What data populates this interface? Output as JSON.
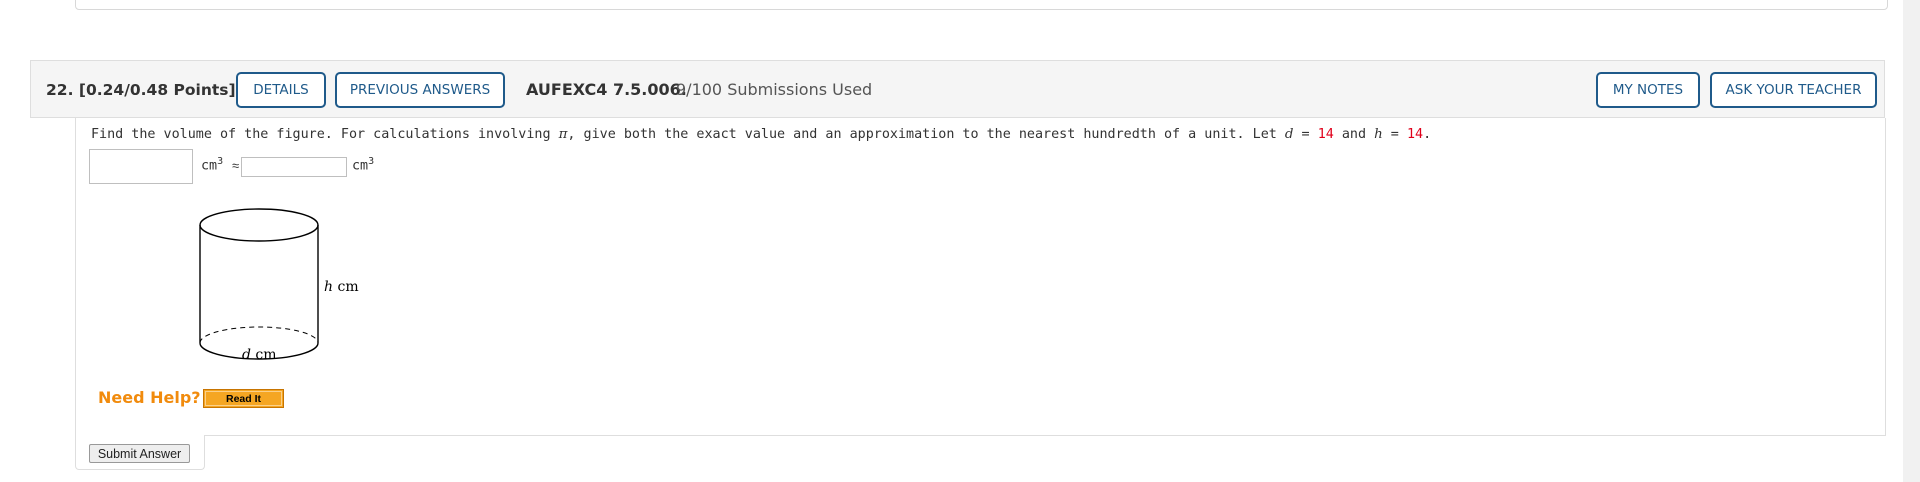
{
  "question": {
    "number": "22.",
    "points": "[0.24/0.48 Points]",
    "details_label": "DETAILS",
    "previous_answers_label": "PREVIOUS ANSWERS",
    "code": "AUFEXC4 7.5.006.",
    "submissions": "9/100 Submissions Used",
    "my_notes_label": "MY NOTES",
    "ask_teacher_label": "ASK YOUR TEACHER"
  },
  "body": {
    "text_before_pi": "Find the volume of the figure. For calculations involving ",
    "pi": "π",
    "text_after_pi": ", give both the exact value and an approximation to the nearest hundredth of a unit. Let ",
    "var_d": "d",
    "eq1": " = ",
    "d_value": "14",
    "and_text": " and ",
    "var_h": "h",
    "eq2": " = ",
    "h_value": "14",
    "period": "."
  },
  "answers": {
    "exact_value": "",
    "approx_value": "",
    "unit": "cm",
    "unit_exp": "3",
    "approx_symbol": "≈"
  },
  "figure": {
    "height_var": "h",
    "height_unit": " cm",
    "diameter_var": "d",
    "diameter_unit": " cm"
  },
  "help": {
    "label": "Need Help?",
    "read_it_label": "Read It"
  },
  "submit_label": "Submit Answer",
  "colors": {
    "button_border": "#1f5a8a",
    "value_red": "#e0001b",
    "help_orange": "#f18b0d",
    "read_it_bg": "#f5a623"
  }
}
